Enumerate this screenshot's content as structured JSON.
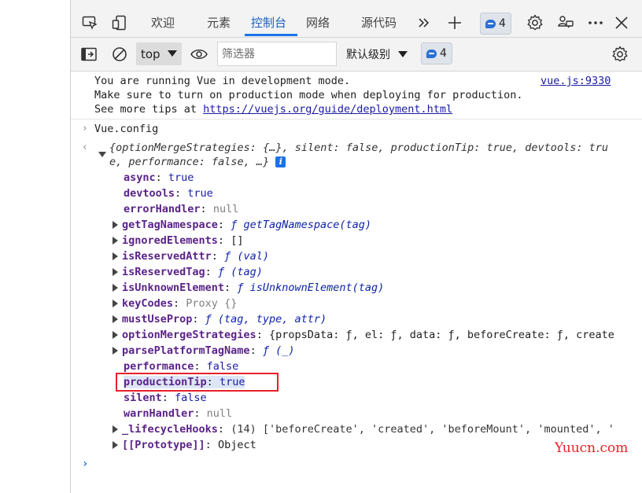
{
  "tabbar": {
    "tabs": [
      {
        "label": "欢迎",
        "active": false
      },
      {
        "label": "元素",
        "active": false
      },
      {
        "label": "控制台",
        "active": true
      },
      {
        "label": "网络",
        "active": false
      },
      {
        "label": "源代码",
        "active": false
      }
    ],
    "more_tabs_icon": "chevron-double-right-icon",
    "add_tab_icon": "plus-icon",
    "issues_count": "4",
    "settings_icon": "gear-icon",
    "feedback_icon": "people-icon",
    "more_icon": "ellipsis-icon",
    "close_icon": "close-icon"
  },
  "toolbar": {
    "context": "top",
    "filter_placeholder": "筛选器",
    "level": "默认级别",
    "issues_count": "4"
  },
  "console": {
    "message": {
      "line1": "You are running Vue in development mode.",
      "line2": "Make sure to turn on production mode when deploying for production.",
      "line3_prefix": "See more tips at ",
      "line3_link": "https://vuejs.org/guide/deployment.html",
      "source": "vue.js:9330"
    },
    "input_expression": "Vue.config",
    "result_summary_line1": "{optionMergeStrategies: {…}, silent: false, productionTip: true, devtools: tru",
    "result_summary_line2": "e, performance: false, …}",
    "properties": [
      {
        "key": "async",
        "value": "true",
        "kind": "kw",
        "expandable": false
      },
      {
        "key": "devtools",
        "value": "true",
        "kind": "kw",
        "expandable": false
      },
      {
        "key": "errorHandler",
        "value": "null",
        "kind": "null",
        "expandable": false
      },
      {
        "key": "getTagNamespace",
        "value": "ƒ getTagNamespace(tag)",
        "kind": "fn",
        "expandable": true
      },
      {
        "key": "ignoredElements",
        "value": "[]",
        "kind": "plain",
        "expandable": true
      },
      {
        "key": "isReservedAttr",
        "value": "ƒ (val)",
        "kind": "fn",
        "expandable": true
      },
      {
        "key": "isReservedTag",
        "value": "ƒ (tag)",
        "kind": "fn",
        "expandable": true
      },
      {
        "key": "isUnknownElement",
        "value": "ƒ isUnknownElement(tag)",
        "kind": "fn",
        "expandable": true
      },
      {
        "key": "keyCodes",
        "value": "Proxy {}",
        "kind": "proxy",
        "expandable": true
      },
      {
        "key": "mustUseProp",
        "value": "ƒ (tag, type, attr)",
        "kind": "fn",
        "expandable": true
      },
      {
        "key": "optionMergeStrategies",
        "value": "{propsData: ƒ, el: ƒ, data: ƒ, beforeCreate: ƒ, create",
        "kind": "plain",
        "expandable": true
      },
      {
        "key": "parsePlatformTagName",
        "value": "ƒ (_)",
        "kind": "fn",
        "expandable": true
      },
      {
        "key": "performance",
        "value": "false",
        "kind": "kw",
        "expandable": false
      },
      {
        "key": "productionTip",
        "value": "true",
        "kind": "kw",
        "expandable": false,
        "highlighted": true
      },
      {
        "key": "silent",
        "value": "false",
        "kind": "kw",
        "expandable": false
      },
      {
        "key": "warnHandler",
        "value": "null",
        "kind": "null",
        "expandable": false
      },
      {
        "key": "_lifecycleHooks",
        "value": "(14) ['beforeCreate', 'created', 'beforeMount', 'mounted', '",
        "kind": "arr",
        "expandable": true
      },
      {
        "key": "[[Prototype]]",
        "value": "Object",
        "kind": "proto",
        "expandable": true
      }
    ]
  },
  "watermark": "Yuucn.com",
  "colors": {
    "accent": "#1a73e8",
    "highlight_border": "#e8202a",
    "keyword": "#1a1aa6",
    "property_key": "#881280"
  }
}
